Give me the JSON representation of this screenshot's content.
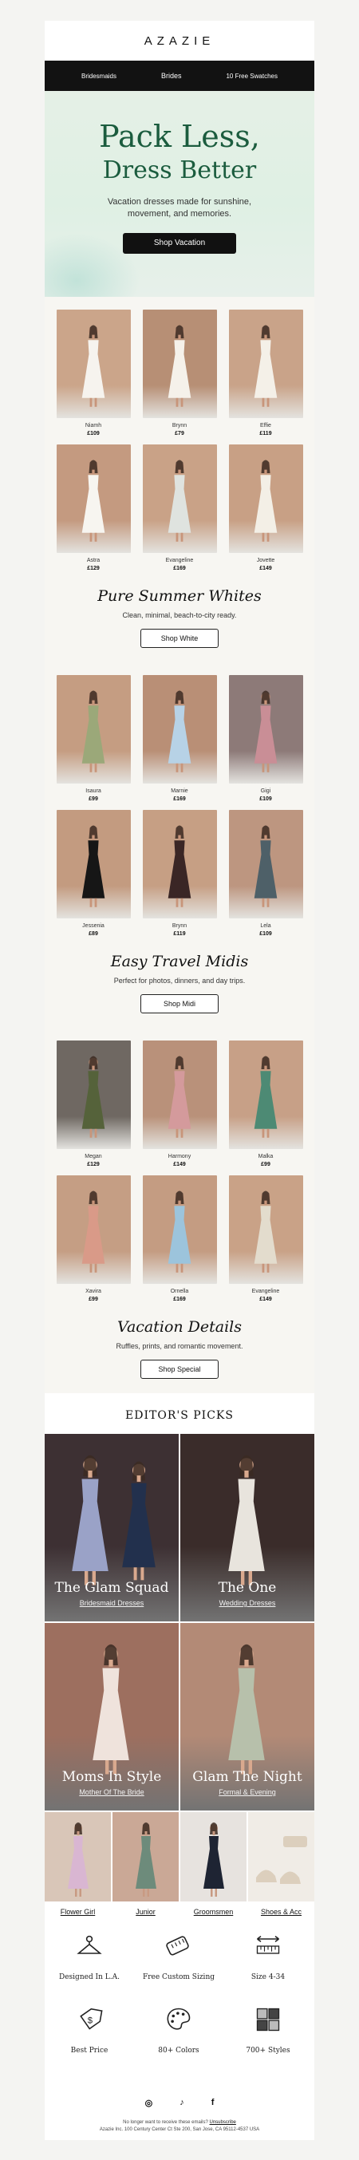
{
  "brand": {
    "logo": "AZAZIE"
  },
  "nav": {
    "items": [
      "Bridesmaids",
      "Brides",
      "10 Free Swatches"
    ]
  },
  "hero": {
    "title_line1": "Pack Less,",
    "title_line2": "Dress Better",
    "subtitle_line1": "Vacation dresses made for sunshine,",
    "subtitle_line2": "movement, and memories.",
    "cta": "Shop Vacation"
  },
  "grid1": [
    {
      "name": "Niamh",
      "price": "£109",
      "bg": "#cba58a",
      "dress": "#f6f3ee"
    },
    {
      "name": "Brynn",
      "price": "£79",
      "bg": "#b78f75",
      "dress": "#f5f1ea"
    },
    {
      "name": "Effie",
      "price": "£119",
      "bg": "#c9a389",
      "dress": "#f4f0e8"
    },
    {
      "name": "Astra",
      "price": "£129",
      "bg": "#c49a80",
      "dress": "#f7f5f0"
    },
    {
      "name": "Evangeline",
      "price": "£169",
      "bg": "#c9a287",
      "dress": "#dfe3df"
    },
    {
      "name": "Jovette",
      "price": "£149",
      "bg": "#c8a085",
      "dress": "#f3efe6"
    }
  ],
  "section1": {
    "title": "Pure Summer Whites",
    "desc": "Clean, minimal, beach-to-city ready.",
    "cta": "Shop White"
  },
  "grid2": [
    {
      "name": "Isaura",
      "price": "£99",
      "bg": "#c59d82",
      "dress": "#9ba879"
    },
    {
      "name": "Marnie",
      "price": "£169",
      "bg": "#b98f76",
      "dress": "#b7d2e6"
    },
    {
      "name": "Gigi",
      "price": "£109",
      "bg": "#8d7a78",
      "dress": "#c98e96"
    },
    {
      "name": "Jessenia",
      "price": "£89",
      "bg": "#c39b80",
      "dress": "#161616"
    },
    {
      "name": "Brynn",
      "price": "£119",
      "bg": "#c69f84",
      "dress": "#3a2625"
    },
    {
      "name": "Lela",
      "price": "£109",
      "bg": "#bd9680",
      "dress": "#4e6068"
    }
  ],
  "section2": {
    "title": "Easy Travel Midis",
    "desc": "Perfect for photos, dinners, and day trips.",
    "cta": "Shop Midi"
  },
  "grid3": [
    {
      "name": "Megan",
      "price": "£129",
      "bg": "#6f6862",
      "dress": "#55623a"
    },
    {
      "name": "Harmony",
      "price": "£149",
      "bg": "#b9917a",
      "dress": "#d49a9c"
    },
    {
      "name": "Malka",
      "price": "£99",
      "bg": "#c7a087",
      "dress": "#4d8a74"
    },
    {
      "name": "Xavira",
      "price": "£99",
      "bg": "#c59e84",
      "dress": "#d99a88"
    },
    {
      "name": "Ornella",
      "price": "£169",
      "bg": "#c49c82",
      "dress": "#9cc4dc"
    },
    {
      "name": "Evangeline",
      "price": "£149",
      "bg": "#c9a287",
      "dress": "#e3dccd"
    }
  ],
  "section3": {
    "title": "Vacation Details",
    "desc": "Ruffles, prints, and romantic movement.",
    "cta": "Shop Special"
  },
  "editor": {
    "title": "EDITOR'S PICKS",
    "tiles": [
      {
        "title": "The Glam Squad",
        "sub": "Bridesmaid Dresses",
        "bg": "#3d3033",
        "dress": "#9aa2c7"
      },
      {
        "title": "The One",
        "sub": "Wedding Dresses",
        "bg": "#3a2c2a",
        "dress": "#e8e4dd"
      },
      {
        "title": "Moms In Style",
        "sub": "Mother Of The Bride",
        "bg": "#9d6f5f",
        "dress": "#efe3dc"
      },
      {
        "title": "Glam The Night",
        "sub": "Formal & Evening",
        "bg": "#b38a76",
        "dress": "#b7c0ab"
      }
    ]
  },
  "categories": [
    {
      "label": "Flower Girl",
      "bg": "#d9c6b8",
      "item": "#d9b6d2"
    },
    {
      "label": "Junior",
      "bg": "#caa896",
      "item": "#6d8b7b"
    },
    {
      "label": "Groomsmen",
      "bg": "#e7e3df",
      "item": "#1e2433"
    },
    {
      "label": "Shoes & Acc",
      "bg": "#f0ece6",
      "item": "#dccfbd"
    }
  ],
  "perks": [
    {
      "label": "Designed In L.A.",
      "icon": "hanger-icon"
    },
    {
      "label": "Free Custom Sizing",
      "icon": "measuring-tape-icon"
    },
    {
      "label": "Size 4-34",
      "icon": "ruler-arrows-icon"
    },
    {
      "label": "Best Price",
      "icon": "price-tag-icon"
    },
    {
      "label": "80+ Colors",
      "icon": "palette-icon"
    },
    {
      "label": "700+ Styles",
      "icon": "grid-styles-icon"
    }
  ],
  "social": {
    "instagram": "◎",
    "tiktok": "♪",
    "facebook": "f"
  },
  "footer": {
    "unsub_prefix": "No longer want to receive these emails?",
    "unsub_link": "Unsubscribe",
    "address": "Azazie Inc. 100 Century Center Ct Ste 200, San Jose, CA 95112-4537 USA"
  }
}
